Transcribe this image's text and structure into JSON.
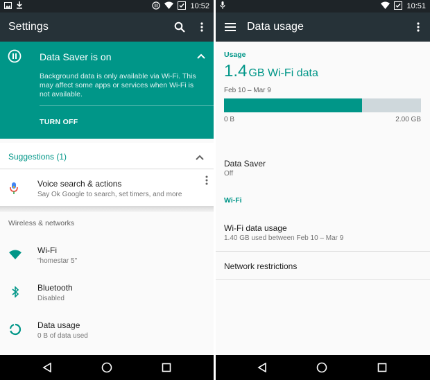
{
  "left": {
    "status_time": "10:52",
    "title": "Settings",
    "data_saver": {
      "title": "Data Saver is on",
      "body": "Background data is only available via Wi-Fi. This may affect some apps or services when Wi-Fi is not available.",
      "action": "TURN OFF"
    },
    "suggestions": {
      "header": "Suggestions (1)",
      "item_title": "Voice search & actions",
      "item_sub": "Say Ok Google to search, set timers, and more"
    },
    "section_header": "Wireless & networks",
    "settings": [
      {
        "title": "Wi-Fi",
        "sub": "\"homestar 5\""
      },
      {
        "title": "Bluetooth",
        "sub": "Disabled"
      },
      {
        "title": "Data usage",
        "sub": "0 B of data used"
      }
    ]
  },
  "right": {
    "status_time": "10:51",
    "title": "Data usage",
    "usage_header": "Usage",
    "usage_amount": "1.4",
    "usage_unit": "GB Wi-Fi data",
    "date_range": "Feb 10 – Mar 9",
    "usage_fraction": 0.7,
    "bar_min": "0 B",
    "bar_max": "2.00 GB",
    "data_saver_title": "Data Saver",
    "data_saver_sub": "Off",
    "wifi_header": "Wi-Fi",
    "wifi_usage_title": "Wi-Fi data usage",
    "wifi_usage_sub": "1.40 GB used between Feb 10 – Mar 9",
    "network_restrictions": "Network restrictions"
  },
  "colors": {
    "accent": "#009688",
    "appbar": "#263238",
    "statusbar": "#1e2428"
  }
}
